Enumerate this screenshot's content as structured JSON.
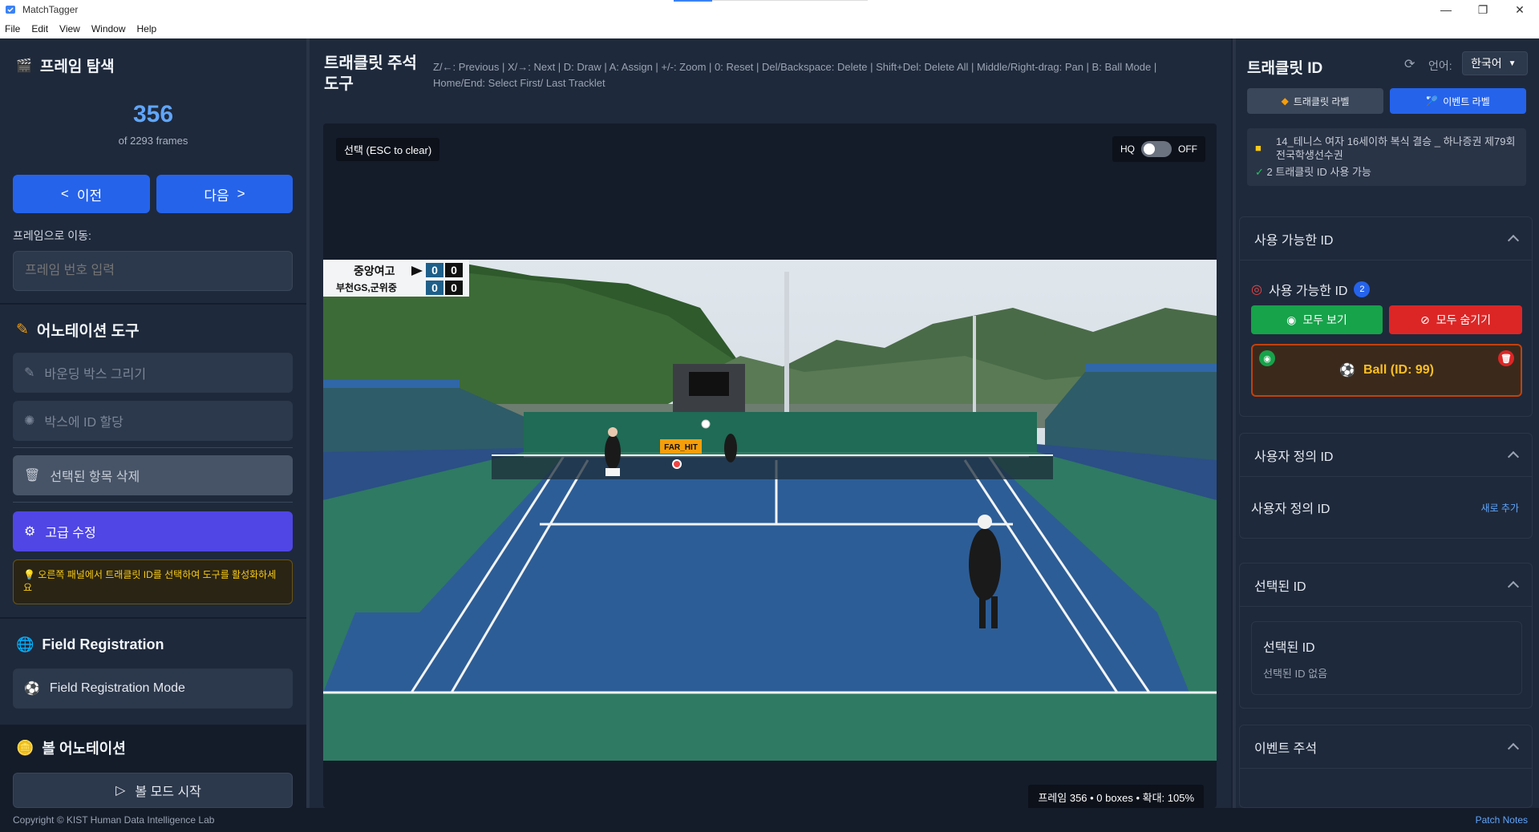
{
  "window": {
    "title": "MatchTagger"
  },
  "menu": [
    "File",
    "Edit",
    "View",
    "Window",
    "Help"
  ],
  "left": {
    "frame_nav_title": "프레임 탐색",
    "frame_number": "356",
    "frame_total": "of 2293 frames",
    "prev_label": "이전",
    "next_label": "다음",
    "goto_label": "프레임으로 이동:",
    "goto_placeholder": "프레임 번호 입력",
    "annot_title": "어노테이션 도구",
    "draw_label": "바운딩 박스 그리기",
    "assign_label": "박스에 ID 할당",
    "delete_label": "선택된 항목 삭제",
    "advanced_label": "고급 수정",
    "hint": "오른쪽 패널에서 트래클릿 ID를 선택하여 도구를 활성화하세요",
    "field_title": "Field Registration",
    "field_mode_label": "Field Registration Mode",
    "ball_title": "볼 어노테이션",
    "ball_start_label": "볼 모드 시작"
  },
  "center": {
    "title": "트래클릿 주석 도구",
    "shortcuts": "Z/←: Previous | X/→: Next | D: Draw | A: Assign | +/-: Zoom | 0: Reset | Del/Backspace: Delete | Shift+Del: Delete All | Middle/Right-drag: Pan | B: Ball Mode | Home/End: Select First/ Last Tracklet",
    "selection_badge": "선택 (ESC to clear)",
    "hq_label": "HQ",
    "hq_state": "OFF",
    "frame_info": "프레임 356 • 0 boxes • 확대: 105%",
    "scoreboard": {
      "team1": "중앙여고",
      "team1_s1": "0",
      "team1_s2": "0",
      "team2": "부천GS,군위중",
      "team2_s1": "0",
      "team2_s2": "0"
    },
    "event_tag": "FAR_HIT"
  },
  "right": {
    "title": "트래클릿 ID",
    "lang_label": "언어:",
    "lang_value": "한국어",
    "tab_tracklet": "트래클릿 라벨",
    "tab_event": "이벤트 라벨",
    "file_name": "14_테니스 여자 16세이하 복식 결승 _ 하나증권 제79회 전국학생선수권",
    "file_status": "2 트래클릿 ID 사용 가능",
    "available_section": "사용 가능한 ID",
    "available_label": "사용 가능한 ID",
    "available_count": "2",
    "show_all": "모두 보기",
    "hide_all": "모두 숨기기",
    "ball_item": "Ball (ID: 99)",
    "custom_section": "사용자 정의 ID",
    "custom_label": "사용자 정의 ID",
    "add_new": "새로 추가",
    "selected_section": "선택된 ID",
    "selected_label": "선택된 ID",
    "selected_none": "선택된 ID 없음",
    "event_section": "이벤트 주석"
  },
  "footer": {
    "copyright": "Copyright © KIST Human Data Intelligence Lab",
    "patch_notes": "Patch Notes"
  }
}
